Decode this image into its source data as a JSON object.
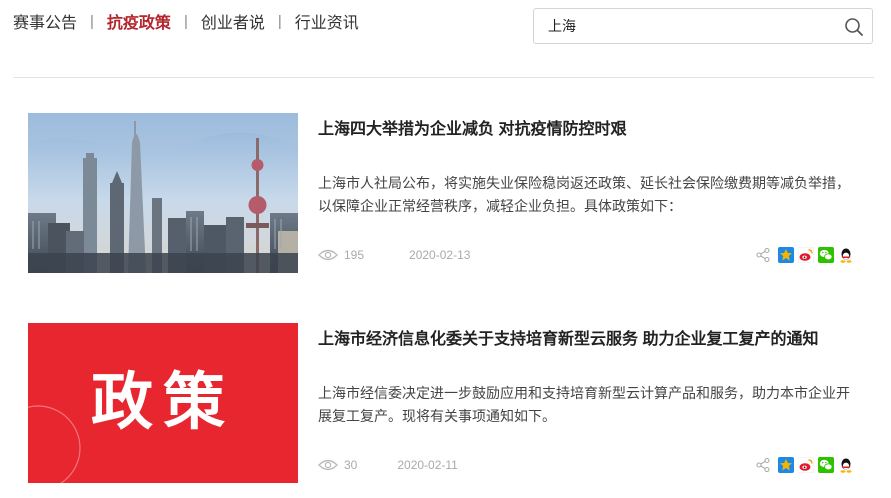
{
  "nav": {
    "tabs": [
      {
        "label": "赛事公告",
        "active": false
      },
      {
        "label": "抗疫政策",
        "active": true
      },
      {
        "label": "创业者说",
        "active": false
      },
      {
        "label": "行业资讯",
        "active": false
      }
    ],
    "separator": "|"
  },
  "search": {
    "value": "上海",
    "icon": "search-icon"
  },
  "articles": [
    {
      "title": "上海四大举措为企业减负 对抗疫情防控时艰",
      "summary": "上海市人社局公布，将实施失业保险稳岗返还政策、延长社会保险缴费期等减负举措，以保障企业正常经营秩序，减轻企业负担。具体政策如下：",
      "views": "195",
      "date": "2020-02-13",
      "thumbnail": "shanghai-skyline-photo"
    },
    {
      "title": "上海市经济信息化委关于支持培育新型云服务 助力企业复工复产的通知",
      "summary": "上海市经信委决定进一步鼓励应用和支持培育新型云计算产品和服务，助力本市企业开展复工复产。现将有关事项通知如下。",
      "views": "30",
      "date": "2020-02-11",
      "thumbnail": "policy-banner",
      "thumbnail_text": "政策"
    }
  ],
  "share_icons": [
    "share-icon",
    "qzone-icon",
    "weibo-icon",
    "wechat-icon",
    "qq-icon"
  ],
  "colors": {
    "accent": "#b3262d",
    "policy_red": "#e8262f",
    "qzone": "#f6b400",
    "weibo": "#e6162d",
    "wechat": "#2dc100",
    "qq": "#1e9fff"
  }
}
